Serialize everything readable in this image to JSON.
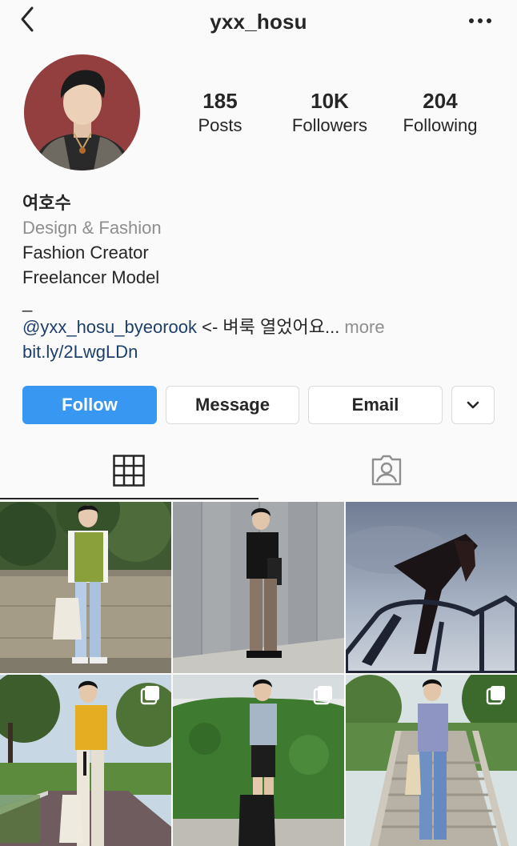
{
  "header": {
    "username": "yxx_hosu",
    "back_icon": "chevron-left-icon",
    "more_icon": "more-horizontal-icon"
  },
  "stats": {
    "posts": {
      "value": "185",
      "label": "Posts"
    },
    "followers": {
      "value": "10K",
      "label": "Followers"
    },
    "following": {
      "value": "204",
      "label": "Following"
    }
  },
  "bio": {
    "name": "여호수",
    "category": "Design & Fashion",
    "line1": "Fashion Creator",
    "line2": "Freelancer Model",
    "line3": "_",
    "mention": "@yxx_hosu_byeorook",
    "mention_text": " <- 벼룩 열었어요...",
    "more": " more",
    "link": "bit.ly/2LwgLDn"
  },
  "actions": {
    "follow": "Follow",
    "message": "Message",
    "email": "Email",
    "dropdown_icon": "chevron-down-icon"
  },
  "tabs": {
    "grid_icon": "grid-icon",
    "tagged_icon": "tagged-person-icon"
  },
  "colors": {
    "accent": "#3897f0",
    "text": "#262626",
    "secondary": "#8e8e8e",
    "link": "#1d3f6b",
    "border": "#dbdbdb",
    "background": "#fafafa"
  }
}
